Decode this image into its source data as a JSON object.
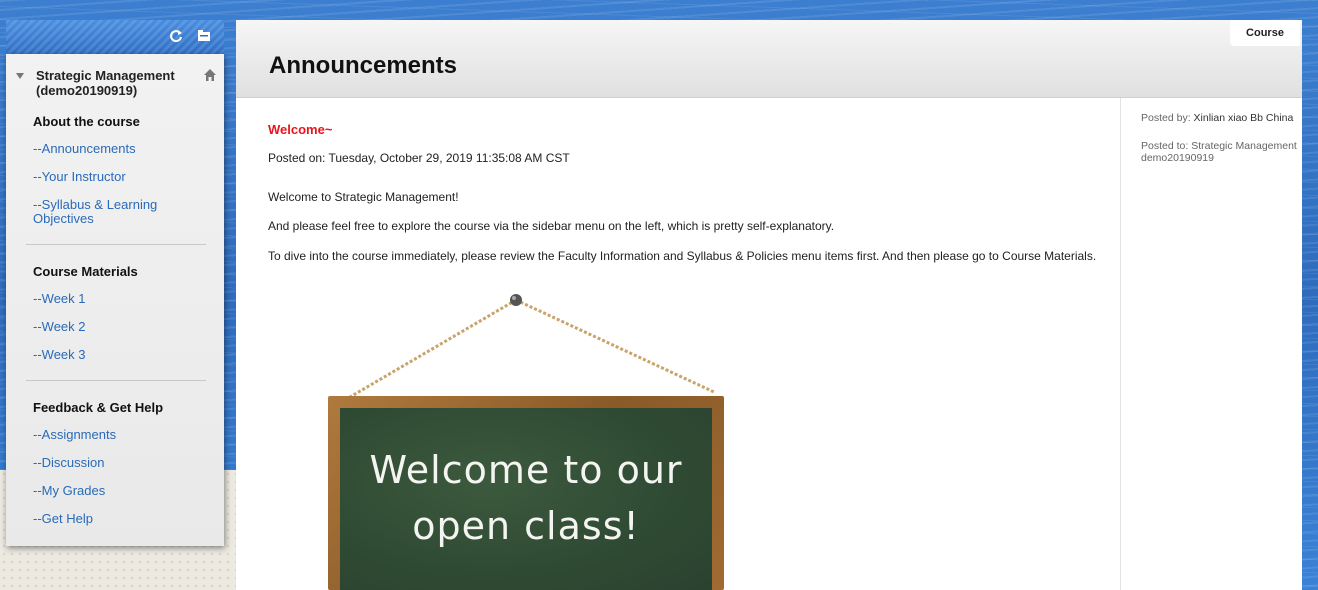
{
  "sidebar": {
    "course_title": "Strategic Management (demo20190919)",
    "sections": [
      {
        "title": "About the course",
        "items": [
          {
            "label": "--Announcements"
          },
          {
            "label": "--Your Instructor"
          },
          {
            "label": "--Syllabus & Learning Objectives"
          }
        ]
      },
      {
        "title": "Course Materials",
        "items": [
          {
            "label": "--Week 1"
          },
          {
            "label": "--Week 2"
          },
          {
            "label": "--Week 3"
          }
        ]
      },
      {
        "title": "Feedback & Get Help",
        "items": [
          {
            "label": "--Assignments"
          },
          {
            "label": "--Discussion"
          },
          {
            "label": "--My Grades"
          },
          {
            "label": "--Get Help"
          }
        ]
      }
    ]
  },
  "main": {
    "page_title": "Announcements",
    "course_tab": "Course",
    "announcement": {
      "title": "Welcome~",
      "posted_on": "Posted on: Tuesday, October 29, 2019 11:35:08 AM CST",
      "paragraphs": [
        "Welcome to Strategic Management!",
        "And please feel free to explore the course via the sidebar menu on the left, which is pretty self-explanatory.",
        "To dive into the course immediately, please review  the Faculty Information and Syllabus & Policies menu items first. And then please go to Course Materials."
      ],
      "image_text_line1": "Welcome to our",
      "image_text_line2": "open class!"
    },
    "meta": {
      "posted_by_label": "Posted by:",
      "posted_by_value": "Xinlian xiao Bb China",
      "posted_to_label": "Posted to:",
      "posted_to_value": "Strategic Management demo20190919"
    }
  },
  "colors": {
    "link": "#2a6ab8",
    "announcement_title": "#e8141b",
    "background_blue": "#2e6cbd"
  },
  "icons": [
    "refresh-icon",
    "folder-icon",
    "home-icon",
    "collapse-triangle-icon"
  ]
}
